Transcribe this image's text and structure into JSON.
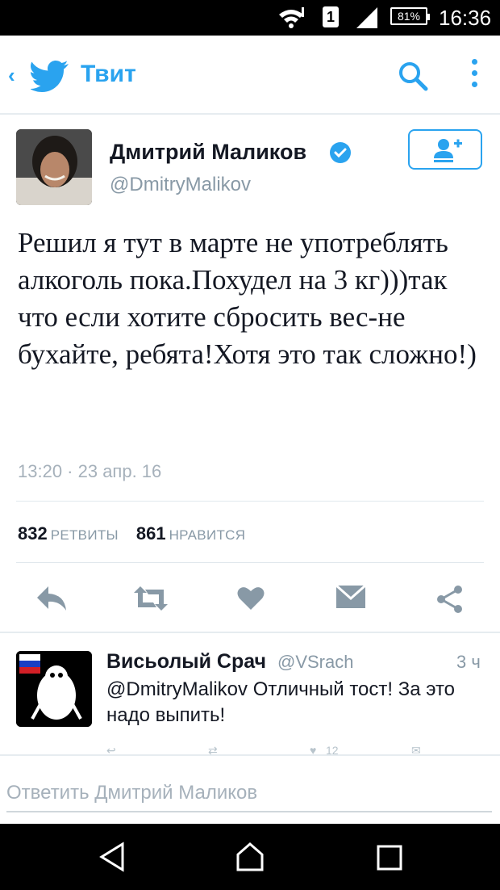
{
  "status_bar": {
    "sim_label": "1",
    "battery": "81%",
    "time": "16:36"
  },
  "app_bar": {
    "title": "Твит",
    "brand_color": "#2aa3ef"
  },
  "tweet": {
    "author_name": "Дмитрий Маликов",
    "author_handle": "@DmitryMalikov",
    "verified": true,
    "text": "Решил я тут в марте не употреблять алкоголь пока.Похудел на 3 кг)))так что если хотите сбросить вес-не бухайте, ребята!Хотя это так сложно!)",
    "timestamp": "13:20 · 23 апр. 16",
    "retweets_count": "832",
    "retweets_label": "РЕТВИТЫ",
    "likes_count": "861",
    "likes_label": "НРАВИТСЯ"
  },
  "reply": {
    "author_name": "Висьолый Срач",
    "author_handle": "@VSrach",
    "time": "3 ч",
    "text": "@DmitryMalikov Отличный тост! За это надо выпить!",
    "likes_count": "12"
  },
  "compose": {
    "placeholder": "Ответить Дмитрий Маликов"
  }
}
